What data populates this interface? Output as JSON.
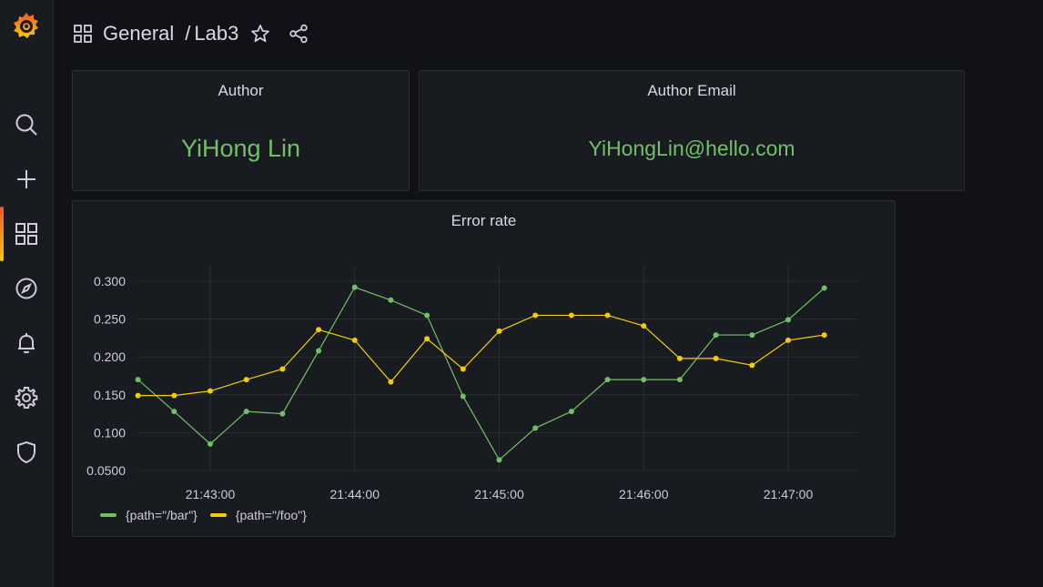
{
  "breadcrumb": {
    "folder": "General",
    "dashboard": "Lab3",
    "separator": "/"
  },
  "sidebar": {
    "items": [
      {
        "name": "search",
        "icon": "search-icon"
      },
      {
        "name": "create",
        "icon": "plus-icon"
      },
      {
        "name": "dashboards",
        "icon": "dashboards-grid-icon",
        "active": true
      },
      {
        "name": "explore",
        "icon": "compass-icon"
      },
      {
        "name": "alerting",
        "icon": "bell-icon"
      },
      {
        "name": "configuration",
        "icon": "gear-icon"
      },
      {
        "name": "server-admin",
        "icon": "shield-icon"
      }
    ]
  },
  "panels": {
    "author": {
      "title": "Author",
      "value": "YiHong Lin"
    },
    "email": {
      "title": "Author Email",
      "value": "YiHongLin@hello.com"
    },
    "error_rate": {
      "title": "Error rate"
    }
  },
  "colors": {
    "bar": "#73bf69",
    "foo": "#f2cc0c",
    "accent": "#f05a28"
  },
  "chart_data": {
    "type": "line",
    "title": "Error rate",
    "x": [
      "21:42:30",
      "21:42:45",
      "21:43:00",
      "21:43:15",
      "21:43:30",
      "21:43:45",
      "21:44:00",
      "21:44:15",
      "21:44:30",
      "21:44:45",
      "21:45:00",
      "21:45:15",
      "21:45:30",
      "21:45:45",
      "21:46:00",
      "21:46:15",
      "21:46:30",
      "21:46:45",
      "21:47:00",
      "21:47:15"
    ],
    "x_ticks": [
      "21:43:00",
      "21:44:00",
      "21:45:00",
      "21:46:00",
      "21:47:00"
    ],
    "y_ticks": [
      "0.0500",
      "0.100",
      "0.150",
      "0.200",
      "0.250",
      "0.300"
    ],
    "ylim": [
      0.05,
      0.3
    ],
    "grid": true,
    "legend_position": "bottom-left",
    "series": [
      {
        "name": "{path=\"/bar\"}",
        "color": "#73bf69",
        "values": [
          0.17,
          0.128,
          0.085,
          0.128,
          0.125,
          0.208,
          0.292,
          0.275,
          0.255,
          0.148,
          0.064,
          0.106,
          0.128,
          0.17,
          0.17,
          0.17,
          0.229,
          0.229,
          0.249,
          0.291
        ]
      },
      {
        "name": "{path=\"/foo\"}",
        "color": "#f2cc0c",
        "values": [
          0.149,
          0.149,
          0.155,
          0.17,
          0.184,
          0.236,
          0.222,
          0.167,
          0.224,
          0.184,
          0.234,
          0.255,
          0.255,
          0.255,
          0.241,
          0.198,
          0.198,
          0.189,
          0.222,
          0.229
        ]
      }
    ]
  }
}
